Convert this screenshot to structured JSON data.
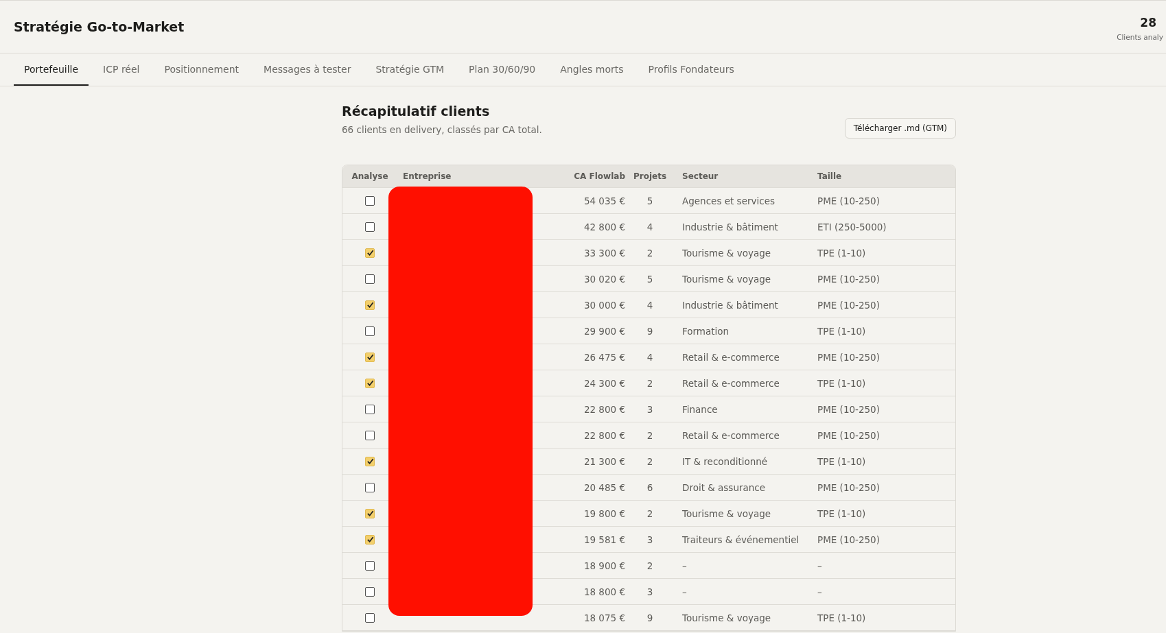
{
  "header": {
    "title": "Stratégie Go-to-Market",
    "stat": {
      "value": "28",
      "label": "Clients analy"
    }
  },
  "tabs": [
    {
      "label": "Portefeuille",
      "selected": true
    },
    {
      "label": "ICP réel",
      "selected": false
    },
    {
      "label": "Positionnement",
      "selected": false
    },
    {
      "label": "Messages à tester",
      "selected": false
    },
    {
      "label": "Stratégie GTM",
      "selected": false
    },
    {
      "label": "Plan 30/60/90",
      "selected": false
    },
    {
      "label": "Angles morts",
      "selected": false
    },
    {
      "label": "Profils Fondateurs",
      "selected": false
    }
  ],
  "section": {
    "title": "Récapitulatif clients",
    "subtitle": "66 clients en delivery, classés par CA total.",
    "download_button": "Télécharger .md (GTM)"
  },
  "table": {
    "columns": [
      "Analyse",
      "Entreprise",
      "CA Flowlab",
      "Projets",
      "Secteur",
      "Taille"
    ],
    "redacted": true,
    "rows": [
      {
        "checked": false,
        "ca": "54 035 €",
        "projets": "5",
        "secteur": "Agences et services",
        "taille": "PME (10-250)"
      },
      {
        "checked": false,
        "ca": "42 800 €",
        "projets": "4",
        "secteur": "Industrie & bâtiment",
        "taille": "ETI (250-5000)"
      },
      {
        "checked": true,
        "ca": "33 300 €",
        "projets": "2",
        "secteur": "Tourisme & voyage",
        "taille": "TPE (1-10)"
      },
      {
        "checked": false,
        "ca": "30 020 €",
        "projets": "5",
        "secteur": "Tourisme & voyage",
        "taille": "PME (10-250)"
      },
      {
        "checked": true,
        "ca": "30 000 €",
        "projets": "4",
        "secteur": "Industrie & bâtiment",
        "taille": "PME (10-250)"
      },
      {
        "checked": false,
        "ca": "29 900 €",
        "projets": "9",
        "secteur": "Formation",
        "taille": "TPE (1-10)"
      },
      {
        "checked": true,
        "ca": "26 475 €",
        "projets": "4",
        "secteur": "Retail & e-commerce",
        "taille": "PME (10-250)"
      },
      {
        "checked": true,
        "ca": "24 300 €",
        "projets": "2",
        "secteur": "Retail & e-commerce",
        "taille": "TPE (1-10)"
      },
      {
        "checked": false,
        "ca": "22 800 €",
        "projets": "3",
        "secteur": "Finance",
        "taille": "PME (10-250)"
      },
      {
        "checked": false,
        "ca": "22 800 €",
        "projets": "2",
        "secteur": "Retail & e-commerce",
        "taille": "PME (10-250)"
      },
      {
        "checked": true,
        "ca": "21 300 €",
        "projets": "2",
        "secteur": "IT & reconditionné",
        "taille": "TPE (1-10)"
      },
      {
        "checked": false,
        "ca": "20 485 €",
        "projets": "6",
        "secteur": "Droit & assurance",
        "taille": "PME (10-250)"
      },
      {
        "checked": true,
        "ca": "19 800 €",
        "projets": "2",
        "secteur": "Tourisme & voyage",
        "taille": "TPE (1-10)"
      },
      {
        "checked": true,
        "ca": "19 581 €",
        "projets": "3",
        "secteur": "Traiteurs & événementiel",
        "taille": "PME (10-250)"
      },
      {
        "checked": false,
        "ca": "18 900 €",
        "projets": "2",
        "secteur": "–",
        "taille": "–"
      },
      {
        "checked": false,
        "ca": "18 800 €",
        "projets": "3",
        "secteur": "–",
        "taille": "–"
      },
      {
        "checked": false,
        "ca": "18 075 €",
        "projets": "9",
        "secteur": "Tourisme & voyage",
        "taille": "TPE (1-10)"
      }
    ]
  }
}
